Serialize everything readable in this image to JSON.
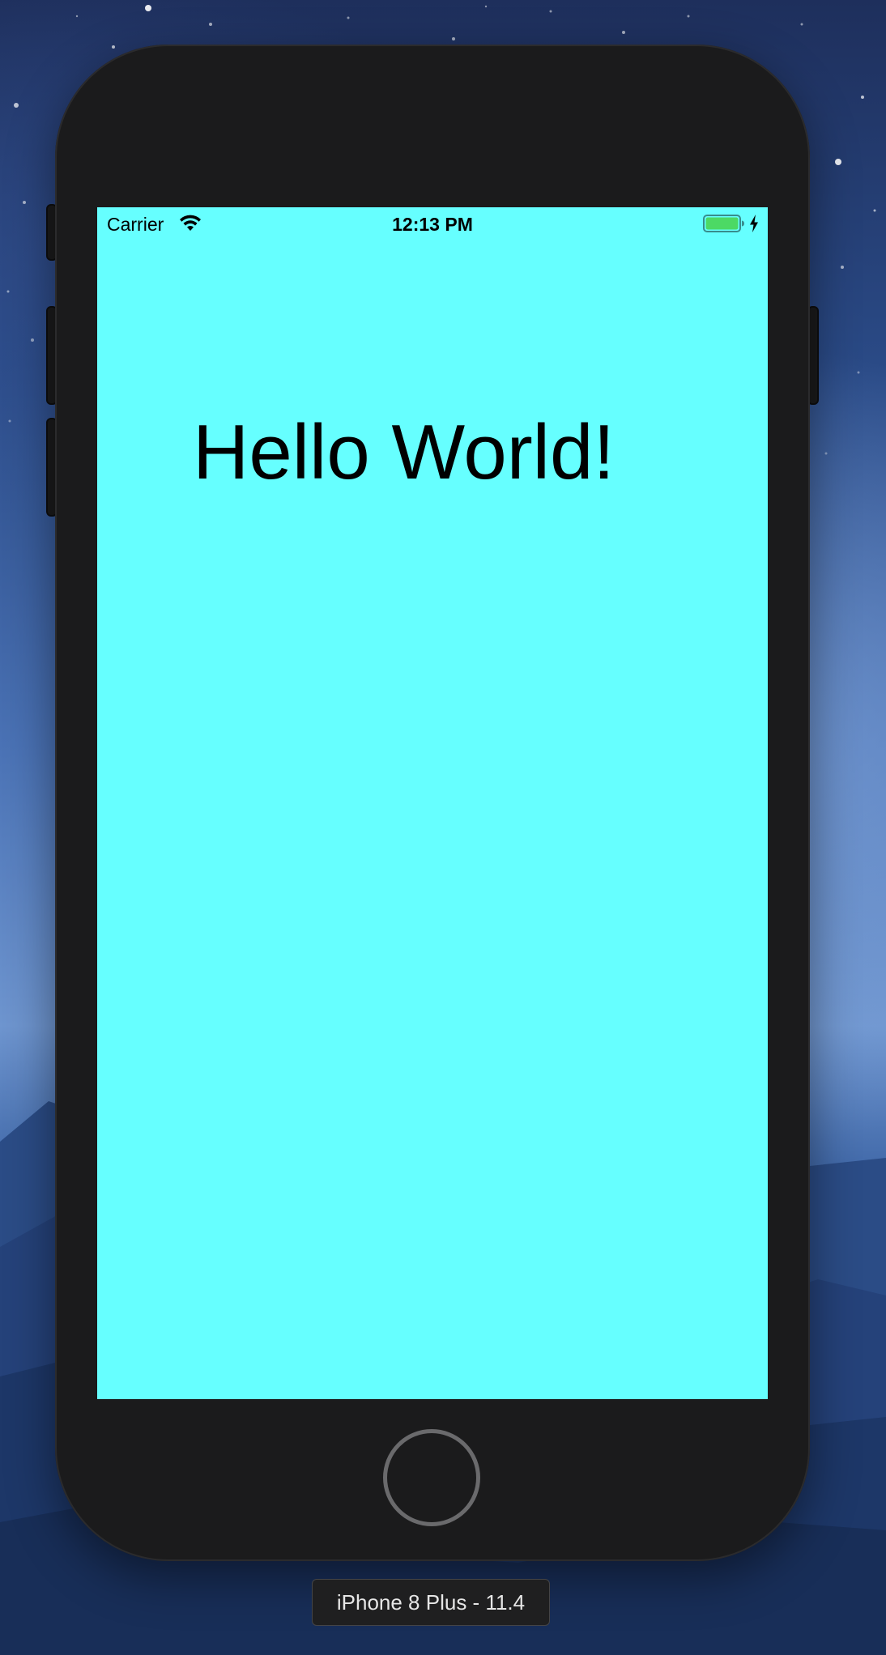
{
  "colors": {
    "screen_background": "#66ffff",
    "device_body": "#1b1b1c",
    "battery_fill": "#4cd964",
    "status_text": "#000000"
  },
  "status_bar": {
    "carrier": "Carrier",
    "time": "12:13 PM",
    "wifi_icon": "wifi-icon",
    "battery_icon": "battery-icon",
    "charging_icon": "charging-bolt-icon",
    "battery_level": 1.0
  },
  "app": {
    "label": "Hello World!"
  },
  "simulator": {
    "device_label": "iPhone 8 Plus - 11.4"
  }
}
